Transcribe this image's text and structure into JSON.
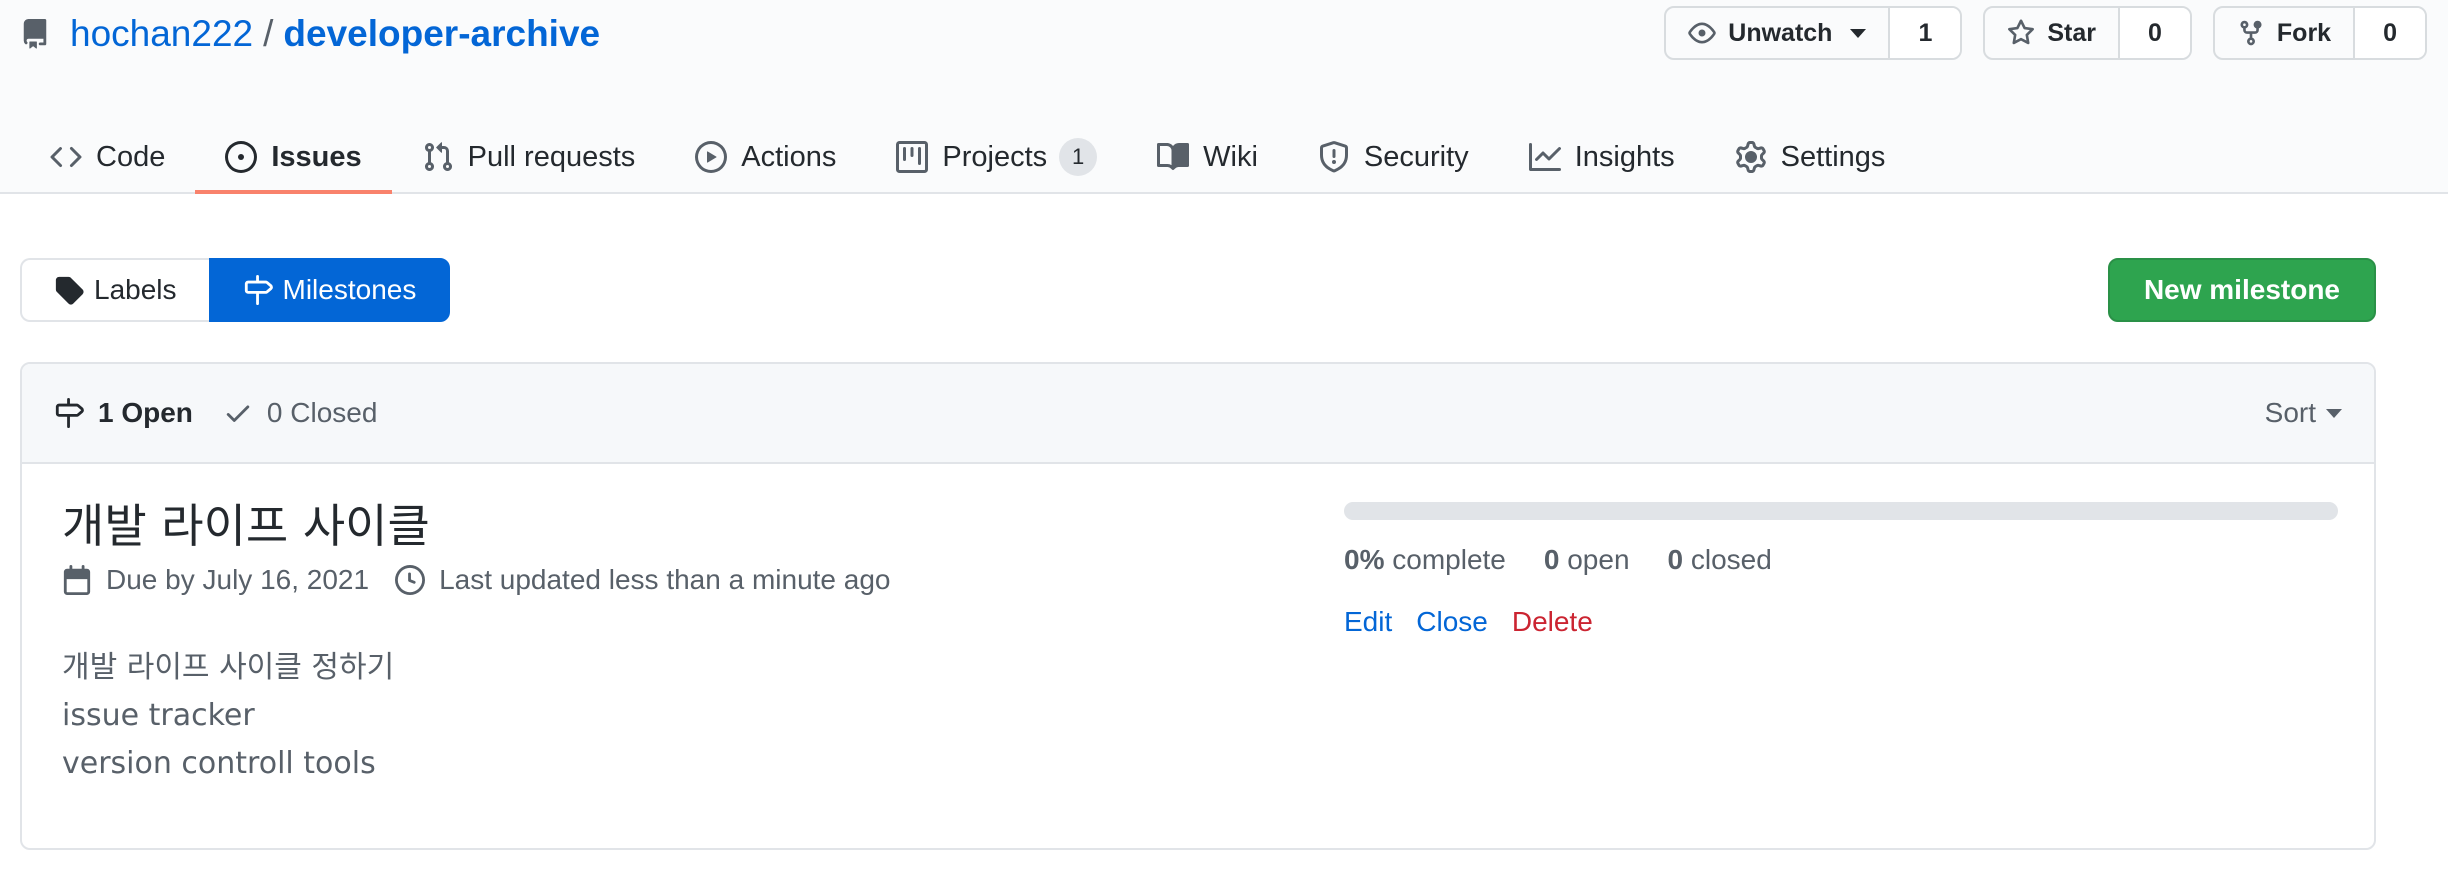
{
  "repo": {
    "owner": "hochan222",
    "separator": "/",
    "name": "developer-archive"
  },
  "actions": {
    "watch": {
      "label": "Unwatch",
      "count": "1"
    },
    "star": {
      "label": "Star",
      "count": "0"
    },
    "fork": {
      "label": "Fork",
      "count": "0"
    }
  },
  "nav": {
    "code": "Code",
    "issues": "Issues",
    "pulls": "Pull requests",
    "actions": "Actions",
    "projects": "Projects",
    "projects_count": "1",
    "wiki": "Wiki",
    "security": "Security",
    "insights": "Insights",
    "settings": "Settings"
  },
  "subnav": {
    "labels": "Labels",
    "milestones": "Milestones",
    "new_milestone": "New milestone"
  },
  "filters": {
    "open": "1 Open",
    "closed": "0 Closed",
    "sort": "Sort"
  },
  "milestone": {
    "title": "개발 라이프 사이클",
    "due": "Due by July 16, 2021",
    "updated": "Last updated less than a minute ago",
    "description": [
      "개발 라이프 사이클 정하기",
      "issue tracker",
      "version controll tools"
    ],
    "progress_percent": 0,
    "percent_label": "0%",
    "complete_label": "complete",
    "open_count": "0",
    "open_label": "open",
    "closed_count": "0",
    "closed_label": "closed",
    "edit": "Edit",
    "close": "Close",
    "delete": "Delete"
  },
  "colors": {
    "link": "#0366d6",
    "primary_green": "#2ea44f",
    "selected_tab_underline": "#f9826c",
    "danger": "#cb2431"
  }
}
